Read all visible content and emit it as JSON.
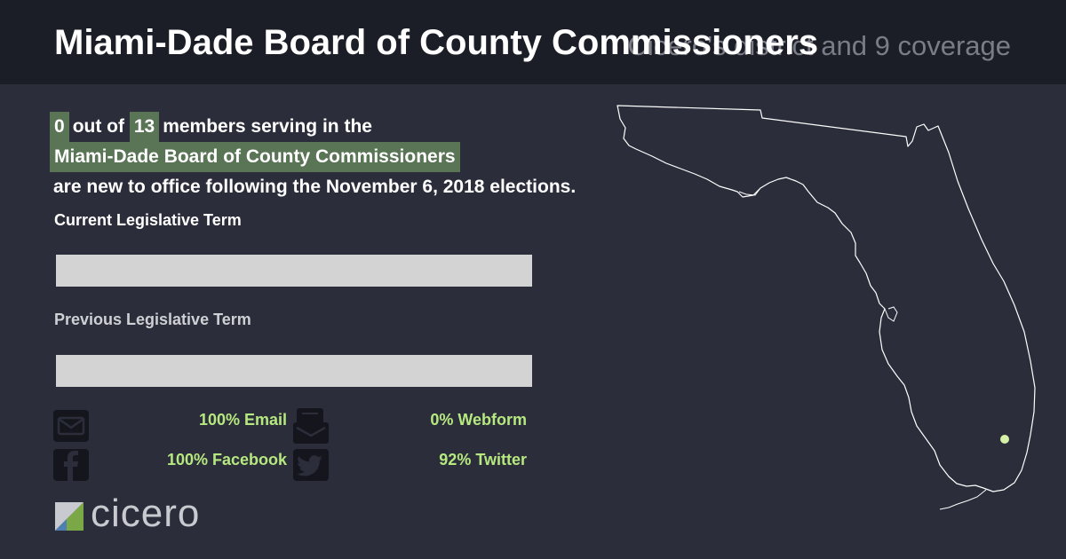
{
  "header": {
    "title": "Miami-Dade Board of County Commissioners",
    "subtitle": "Cicero's district and 9 coverage"
  },
  "summary": {
    "new_count": "0",
    "out_of": "out of",
    "total": "13",
    "serving": "members serving in the",
    "body_name": "Miami-Dade Board of County Commissioners",
    "ending": "are new to office following the November 6, 2018 elections."
  },
  "terms": {
    "current_label": "Current Legislative Term",
    "current_new_fraction": 0,
    "previous_label": "Previous Legislative Term",
    "previous_new_fraction": 0
  },
  "contact": {
    "email": "100% Email",
    "webform": "0% Webform",
    "facebook": "100% Facebook",
    "twitter": "92% Twitter",
    "icons": [
      "email-icon",
      "webform-icon",
      "facebook-icon",
      "twitter-icon"
    ]
  },
  "brand": {
    "logo_text": "cicero"
  },
  "colors": {
    "highlight": "#5a7556",
    "stat_text": "#b6e880",
    "marker": "#d7f0a8",
    "bar": "#d3d3d3"
  }
}
